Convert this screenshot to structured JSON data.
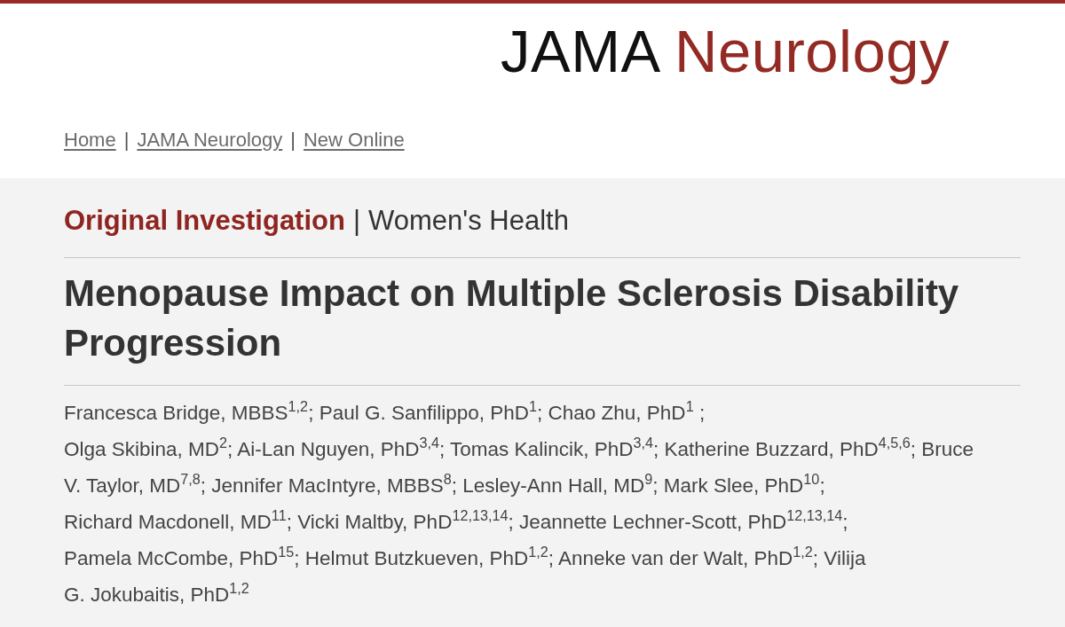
{
  "header": {
    "logo": [
      "JAMA",
      "Neurology"
    ]
  },
  "breadcrumb": [
    {
      "kind": "link",
      "label": "Home"
    },
    {
      "kind": "separator",
      "label": "|"
    },
    {
      "kind": "link",
      "label": "JAMA Neurology"
    },
    {
      "kind": "separator",
      "label": "|"
    },
    {
      "kind": "link",
      "label": "New Online"
    }
  ],
  "article": {
    "type_line": [
      {
        "kind": "type",
        "text": "Original Investigation"
      },
      {
        "kind": "separator",
        "text": "|"
      },
      {
        "kind": "category",
        "text": "Women's Health"
      }
    ],
    "title": "Menopause Impact on Multiple Sclerosis Disability Progression",
    "author_lines": [
      "Francesca Bridge, MBBS$^{1,2}$; Paul G. Sanfilippo, PhD$^{1}$; Chao Zhu, PhD$^{1}$ ;",
      "Olga Skibina, MD$^{2}$; Ai-Lan Nguyen, PhD$^{3,4}$; Tomas Kalincik, PhD$^{3,4}$; Katherine Buzzard, PhD$^{4,5,6}$; Bruce",
      "V. Taylor, MD$^{7,8}$; Jennifer MacIntyre, MBBS$^{8}$; Lesley-Ann Hall, MD$^{9}$; Mark Slee, PhD$^{10}$;",
      "Richard Macdonell, MD$^{11}$; Vicki Maltby, PhD$^{12,13,14}$; Jeannette Lechner-Scott, PhD$^{12,13,14}$;",
      "Pamela McCombe, PhD$^{15}$; Helmut Butzkueven, PhD$^{1,2}$; Anneke van der Walt, PhD$^{1,2}$; Vilija",
      "G. Jokubaitis, PhD$^{1,2}$"
    ]
  }
}
